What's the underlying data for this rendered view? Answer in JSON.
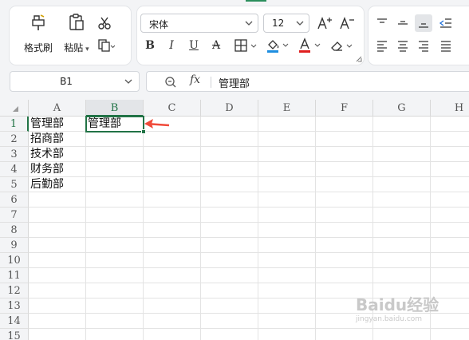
{
  "ribbon": {
    "format_painter_label": "格式刷",
    "paste_label": "粘贴",
    "font_name": "宋体",
    "font_size": "12",
    "bold": "B",
    "italic": "I",
    "underline": "U",
    "strike": "A",
    "grow_font": "A⁺",
    "shrink_font": "A⁻",
    "font_color": "#e02020",
    "fill_color": "#1e8ee0"
  },
  "formula_bar": {
    "name_box": "B1",
    "fx_label": "fx",
    "value": "管理部"
  },
  "grid": {
    "columns": [
      "A",
      "B",
      "C",
      "D",
      "E",
      "F",
      "G",
      "H"
    ],
    "rows": [
      "1",
      "2",
      "3",
      "4",
      "5",
      "6",
      "7",
      "8",
      "9",
      "10",
      "11",
      "12",
      "13",
      "14",
      "15"
    ],
    "active_column": "B",
    "active_row": "1",
    "cells": {
      "A1": "管理部",
      "A2": "招商部",
      "A3": "技术部",
      "A4": "财务部",
      "A5": "后勤部",
      "B1": "管理部"
    }
  },
  "watermark": {
    "line1": "Baidu经验",
    "line2": "jingyan.baidu.com"
  }
}
